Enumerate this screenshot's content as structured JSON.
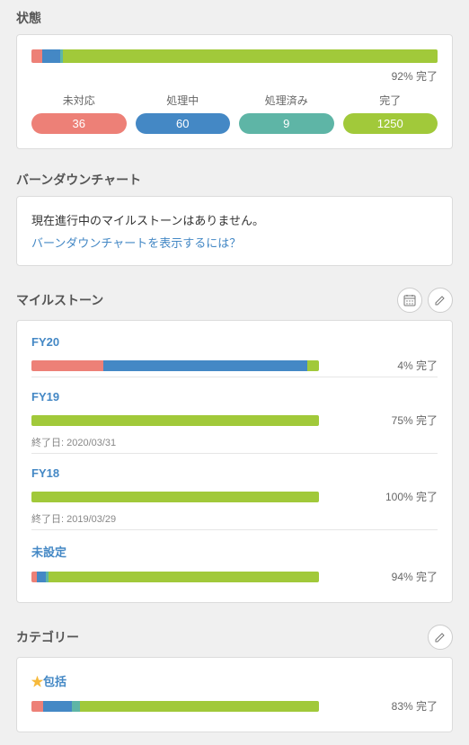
{
  "labels": {
    "complete_suffix": "完了",
    "end_date_prefix": "終了日: "
  },
  "status": {
    "title": "状態",
    "percent": "92%",
    "segments": [
      {
        "cls": "seg-red",
        "pct": 2.7
      },
      {
        "cls": "seg-blue",
        "pct": 4.4
      },
      {
        "cls": "seg-teal",
        "pct": 0.7
      },
      {
        "cls": "seg-green",
        "pct": 92.2
      }
    ],
    "columns": [
      {
        "label": "未対応",
        "value": "36",
        "cls": "seg-red"
      },
      {
        "label": "処理中",
        "value": "60",
        "cls": "seg-blue"
      },
      {
        "label": "処理済み",
        "value": "9",
        "cls": "seg-teal"
      },
      {
        "label": "完了",
        "value": "1250",
        "cls": "seg-green"
      }
    ]
  },
  "burndown": {
    "title": "バーンダウンチャート",
    "message": "現在進行中のマイルストーンはありません。",
    "link": "バーンダウンチャートを表示するには？"
  },
  "milestones": {
    "title": "マイルストーン",
    "items": [
      {
        "name": "FY20",
        "percent": "4%",
        "segments": [
          {
            "cls": "seg-red",
            "pct": 25
          },
          {
            "cls": "seg-blue",
            "pct": 71
          },
          {
            "cls": "seg-green",
            "pct": 4
          }
        ]
      },
      {
        "name": "FY19",
        "percent": "75%",
        "segments": [
          {
            "cls": "seg-green",
            "pct": 100
          }
        ],
        "end_date": "2020/03/31"
      },
      {
        "name": "FY18",
        "percent": "100%",
        "segments": [
          {
            "cls": "seg-green",
            "pct": 100
          }
        ],
        "end_date": "2019/03/29"
      },
      {
        "name": "未設定",
        "percent": "94%",
        "segments": [
          {
            "cls": "seg-red",
            "pct": 2
          },
          {
            "cls": "seg-blue",
            "pct": 3
          },
          {
            "cls": "seg-teal",
            "pct": 1
          },
          {
            "cls": "seg-green",
            "pct": 94
          }
        ]
      }
    ]
  },
  "categories": {
    "title": "カテゴリー",
    "items": [
      {
        "name": "包括",
        "star": true,
        "percent": "83%",
        "segments": [
          {
            "cls": "seg-red",
            "pct": 4
          },
          {
            "cls": "seg-blue",
            "pct": 10
          },
          {
            "cls": "seg-teal",
            "pct": 3
          },
          {
            "cls": "seg-green",
            "pct": 83
          }
        ]
      }
    ]
  },
  "chart_data": [
    {
      "type": "bar",
      "title": "状態",
      "orientation": "stacked-horizontal",
      "categories": [
        "未対応",
        "処理中",
        "処理済み",
        "完了"
      ],
      "values": [
        36,
        60,
        9,
        1250
      ],
      "percent_complete": 92
    },
    {
      "type": "bar",
      "title": "マイルストーン FY20",
      "orientation": "stacked-horizontal",
      "series": [
        {
          "name": "未対応",
          "values": [
            25
          ]
        },
        {
          "name": "処理中",
          "values": [
            71
          ]
        },
        {
          "name": "完了",
          "values": [
            4
          ]
        }
      ],
      "percent_complete": 4
    },
    {
      "type": "bar",
      "title": "マイルストーン FY19",
      "orientation": "stacked-horizontal",
      "series": [
        {
          "name": "完了",
          "values": [
            100
          ]
        }
      ],
      "percent_complete": 75,
      "end_date": "2020/03/31"
    },
    {
      "type": "bar",
      "title": "マイルストーン FY18",
      "orientation": "stacked-horizontal",
      "series": [
        {
          "name": "完了",
          "values": [
            100
          ]
        }
      ],
      "percent_complete": 100,
      "end_date": "2019/03/29"
    },
    {
      "type": "bar",
      "title": "マイルストーン 未設定",
      "orientation": "stacked-horizontal",
      "series": [
        {
          "name": "未対応",
          "values": [
            2
          ]
        },
        {
          "name": "処理中",
          "values": [
            3
          ]
        },
        {
          "name": "処理済み",
          "values": [
            1
          ]
        },
        {
          "name": "完了",
          "values": [
            94
          ]
        }
      ],
      "percent_complete": 94
    },
    {
      "type": "bar",
      "title": "カテゴリー ★包括",
      "orientation": "stacked-horizontal",
      "series": [
        {
          "name": "未対応",
          "values": [
            4
          ]
        },
        {
          "name": "処理中",
          "values": [
            10
          ]
        },
        {
          "name": "処理済み",
          "values": [
            3
          ]
        },
        {
          "name": "完了",
          "values": [
            83
          ]
        }
      ],
      "percent_complete": 83
    }
  ]
}
